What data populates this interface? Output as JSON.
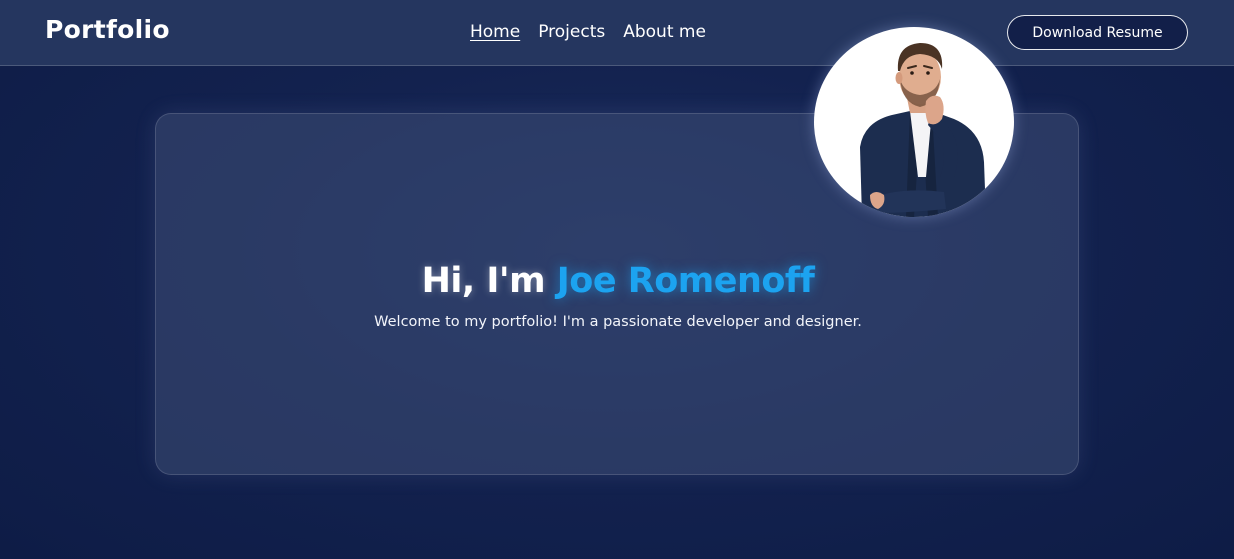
{
  "navbar": {
    "logo": "Portfolio",
    "links": [
      {
        "label": "Home",
        "active": true
      },
      {
        "label": "Projects",
        "active": false
      },
      {
        "label": "About me",
        "active": false
      }
    ],
    "resume_button": "Download Resume"
  },
  "hero": {
    "greeting": "Hi, I'm ",
    "name": "Joe Romenoff",
    "subtitle": "Welcome to my portfolio! I'm a passionate developer and designer."
  },
  "colors": {
    "background": "#13224f",
    "navbar": "#25365f",
    "accent": "#1ca3f0",
    "card": "#2e3d63"
  },
  "avatar": {
    "icon": "profile-photo"
  }
}
